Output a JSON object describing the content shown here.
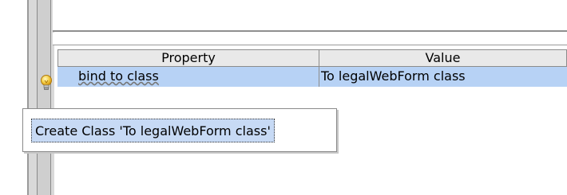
{
  "grid": {
    "headers": {
      "property": "Property",
      "value": "Value"
    },
    "rows": [
      {
        "property": "bind to class",
        "value": "To legalWebForm class",
        "selected": true
      }
    ]
  },
  "quick_fix": {
    "icon": "lightbulb-icon",
    "items": [
      {
        "label": "Create Class 'To legalWebForm class'"
      }
    ]
  },
  "colors": {
    "selected_row": "#b7d2f5",
    "header_bg": "#e9e9e9",
    "popup_highlight": "#c7daf5"
  }
}
